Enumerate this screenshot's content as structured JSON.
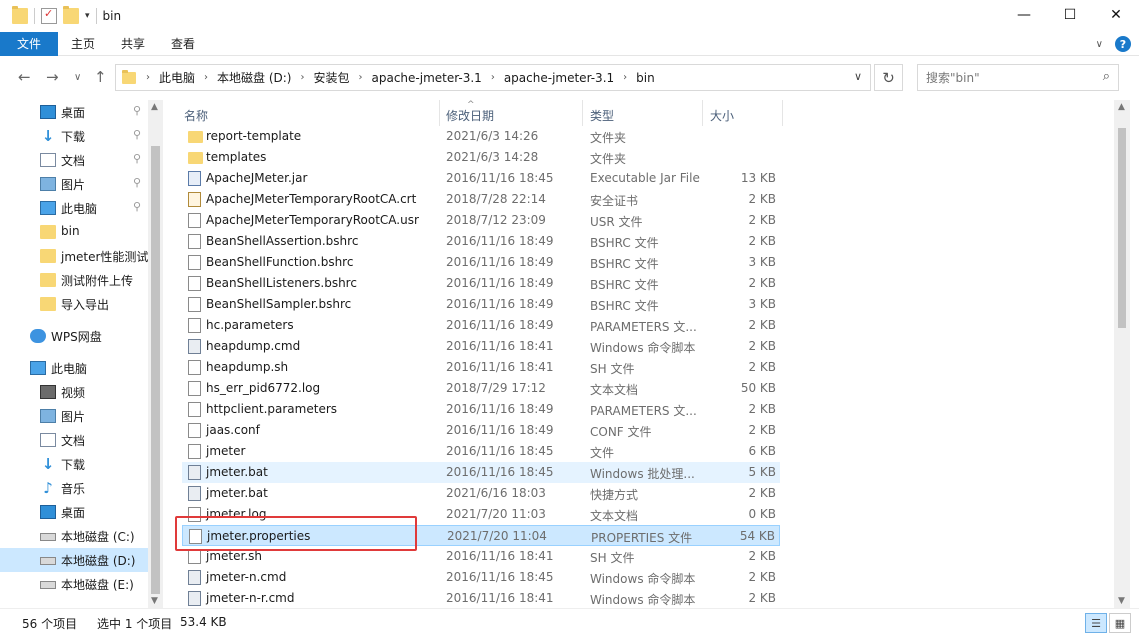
{
  "window": {
    "title": "bin",
    "controls": [
      "—",
      "☐",
      "✕"
    ]
  },
  "ribbon": {
    "tabs": [
      "文件",
      "主页",
      "共享",
      "查看"
    ]
  },
  "address": {
    "crumbs": [
      "此电脑",
      "本地磁盘 (D:)",
      "安装包",
      "apache-jmeter-3.1",
      "apache-jmeter-3.1",
      "bin"
    ],
    "search_placeholder": "搜索\"bin\""
  },
  "nav": {
    "items": [
      {
        "label": "桌面",
        "icon": "desktop-icon",
        "pinned": true
      },
      {
        "label": "下载",
        "icon": "download-icon",
        "pinned": true
      },
      {
        "label": "文档",
        "icon": "document-icon",
        "pinned": true
      },
      {
        "label": "图片",
        "icon": "picture-icon",
        "pinned": true
      },
      {
        "label": "此电脑",
        "icon": "computer-icon",
        "pinned": true
      },
      {
        "label": "bin",
        "icon": "folder-icon",
        "pinned": false
      },
      {
        "label": "jmeter性能测试",
        "icon": "folder-icon",
        "pinned": false
      },
      {
        "label": "测试附件上传",
        "icon": "folder-icon",
        "pinned": false
      },
      {
        "label": "导入导出",
        "icon": "folder-icon",
        "pinned": false
      },
      {
        "label": "WPS网盘",
        "icon": "cloud-icon",
        "pinned": false
      },
      {
        "label": "此电脑",
        "icon": "computer-icon",
        "pinned": false
      },
      {
        "label": "视频",
        "icon": "video-icon",
        "pinned": false
      },
      {
        "label": "图片",
        "icon": "picture-icon",
        "pinned": false
      },
      {
        "label": "文档",
        "icon": "document-icon",
        "pinned": false
      },
      {
        "label": "下载",
        "icon": "download-icon",
        "pinned": false
      },
      {
        "label": "音乐",
        "icon": "music-icon",
        "pinned": false
      },
      {
        "label": "桌面",
        "icon": "desktop-icon",
        "pinned": false
      },
      {
        "label": "本地磁盘 (C:)",
        "icon": "drive-icon",
        "pinned": false
      },
      {
        "label": "本地磁盘 (D:)",
        "icon": "drive-icon",
        "pinned": false,
        "selected": true
      },
      {
        "label": "本地磁盘 (E:)",
        "icon": "drive-icon",
        "pinned": false
      }
    ]
  },
  "columns": {
    "name": "名称",
    "date": "修改日期",
    "type": "类型",
    "size": "大小"
  },
  "files": [
    {
      "name": "report-template",
      "date": "2021/6/3 14:26",
      "type": "文件夹",
      "size": "",
      "icon": "folder"
    },
    {
      "name": "templates",
      "date": "2021/6/3 14:28",
      "type": "文件夹",
      "size": "",
      "icon": "folder"
    },
    {
      "name": "ApacheJMeter.jar",
      "date": "2016/11/16 18:45",
      "type": "Executable Jar File",
      "size": "13 KB",
      "icon": "jar"
    },
    {
      "name": "ApacheJMeterTemporaryRootCA.crt",
      "date": "2018/7/28 22:14",
      "type": "安全证书",
      "size": "2 KB",
      "icon": "crt"
    },
    {
      "name": "ApacheJMeterTemporaryRootCA.usr",
      "date": "2018/7/12 23:09",
      "type": "USR 文件",
      "size": "2 KB",
      "icon": "file"
    },
    {
      "name": "BeanShellAssertion.bshrc",
      "date": "2016/11/16 18:49",
      "type": "BSHRC 文件",
      "size": "2 KB",
      "icon": "file"
    },
    {
      "name": "BeanShellFunction.bshrc",
      "date": "2016/11/16 18:49",
      "type": "BSHRC 文件",
      "size": "3 KB",
      "icon": "file"
    },
    {
      "name": "BeanShellListeners.bshrc",
      "date": "2016/11/16 18:49",
      "type": "BSHRC 文件",
      "size": "2 KB",
      "icon": "file"
    },
    {
      "name": "BeanShellSampler.bshrc",
      "date": "2016/11/16 18:49",
      "type": "BSHRC 文件",
      "size": "3 KB",
      "icon": "file"
    },
    {
      "name": "hc.parameters",
      "date": "2016/11/16 18:49",
      "type": "PARAMETERS 文...",
      "size": "2 KB",
      "icon": "file"
    },
    {
      "name": "heapdump.cmd",
      "date": "2016/11/16 18:41",
      "type": "Windows 命令脚本",
      "size": "2 KB",
      "icon": "cmd"
    },
    {
      "name": "heapdump.sh",
      "date": "2016/11/16 18:41",
      "type": "SH 文件",
      "size": "2 KB",
      "icon": "file"
    },
    {
      "name": "hs_err_pid6772.log",
      "date": "2018/7/29 17:12",
      "type": "文本文档",
      "size": "50 KB",
      "icon": "txt"
    },
    {
      "name": "httpclient.parameters",
      "date": "2016/11/16 18:49",
      "type": "PARAMETERS 文...",
      "size": "2 KB",
      "icon": "file"
    },
    {
      "name": "jaas.conf",
      "date": "2016/11/16 18:49",
      "type": "CONF 文件",
      "size": "2 KB",
      "icon": "file"
    },
    {
      "name": "jmeter",
      "date": "2016/11/16 18:45",
      "type": "文件",
      "size": "6 KB",
      "icon": "file"
    },
    {
      "name": "jmeter.bat",
      "date": "2016/11/16 18:45",
      "type": "Windows 批处理...",
      "size": "5 KB",
      "icon": "cmd",
      "state": "hover"
    },
    {
      "name": "jmeter.bat",
      "date": "2021/6/16 18:03",
      "type": "快捷方式",
      "size": "2 KB",
      "icon": "cmd"
    },
    {
      "name": "jmeter.log",
      "date": "2021/7/20 11:03",
      "type": "文本文档",
      "size": "0 KB",
      "icon": "txt"
    },
    {
      "name": "jmeter.properties",
      "date": "2021/7/20 11:04",
      "type": "PROPERTIES 文件",
      "size": "54 KB",
      "icon": "file",
      "state": "selected"
    },
    {
      "name": "jmeter.sh",
      "date": "2016/11/16 18:41",
      "type": "SH 文件",
      "size": "2 KB",
      "icon": "file"
    },
    {
      "name": "jmeter-n.cmd",
      "date": "2016/11/16 18:45",
      "type": "Windows 命令脚本",
      "size": "2 KB",
      "icon": "cmd"
    },
    {
      "name": "jmeter-n-r.cmd",
      "date": "2016/11/16 18:41",
      "type": "Windows 命令脚本",
      "size": "2 KB",
      "icon": "cmd"
    }
  ],
  "status": {
    "count": "56 个项目",
    "selected": "选中 1 个项目",
    "size": "53.4 KB"
  }
}
